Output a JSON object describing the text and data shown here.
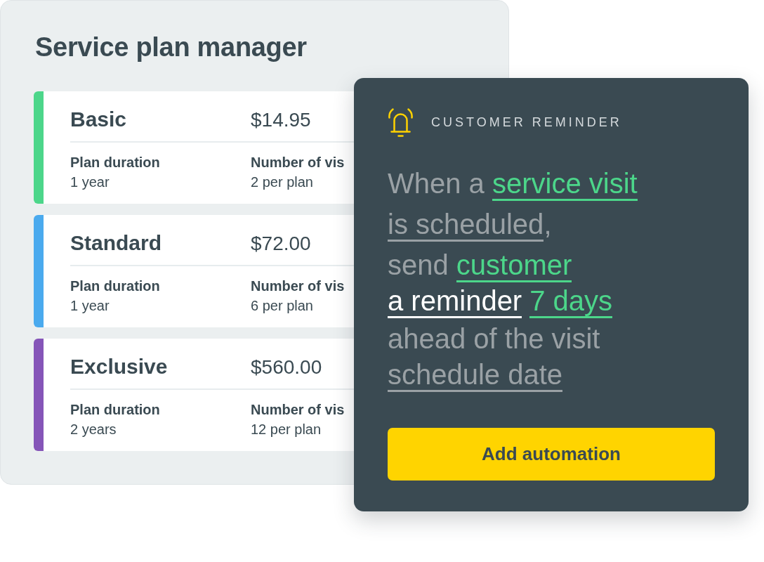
{
  "panel": {
    "title": "Service plan manager",
    "plans": [
      {
        "name": "Basic",
        "price": "$14.95",
        "color": "#4cd68a",
        "fields": [
          {
            "label": "Plan duration",
            "value": "1 year"
          },
          {
            "label": "Number of vis",
            "value": "2 per plan"
          }
        ]
      },
      {
        "name": "Standard",
        "price": "$72.00",
        "color": "#4aaaee",
        "fields": [
          {
            "label": "Plan duration",
            "value": "1 year"
          },
          {
            "label": "Number of vis",
            "value": "6 per plan"
          }
        ]
      },
      {
        "name": "Exclusive",
        "price": "$560.00",
        "color": "#8555b8",
        "fields": [
          {
            "label": "Plan duration",
            "value": "2 years"
          },
          {
            "label": "Number of vis",
            "value": "12 per plan"
          }
        ]
      }
    ]
  },
  "reminder": {
    "heading": "CUSTOMER REMINDER",
    "sentence": {
      "lines": [
        [
          {
            "kind": "text",
            "text": "When a "
          },
          {
            "kind": "token",
            "text": "service visit",
            "color": "#4cd68a"
          }
        ],
        [
          {
            "kind": "token",
            "text": "is scheduled",
            "color": "#9aa1a5"
          },
          {
            "kind": "text",
            "text": ","
          }
        ],
        [
          {
            "kind": "text",
            "text": "send "
          },
          {
            "kind": "token",
            "text": "customer",
            "color": "#4cd68a"
          }
        ],
        [
          {
            "kind": "token",
            "text": "a reminder",
            "color": "#ffffff"
          },
          {
            "kind": "token",
            "text": "7 days",
            "color": "#4cd68a"
          }
        ],
        [
          {
            "kind": "text",
            "text": "ahead of the visit"
          }
        ],
        [
          {
            "kind": "token",
            "text": "schedule date",
            "color": "#9aa1a5"
          }
        ]
      ]
    },
    "button": "Add automation"
  }
}
